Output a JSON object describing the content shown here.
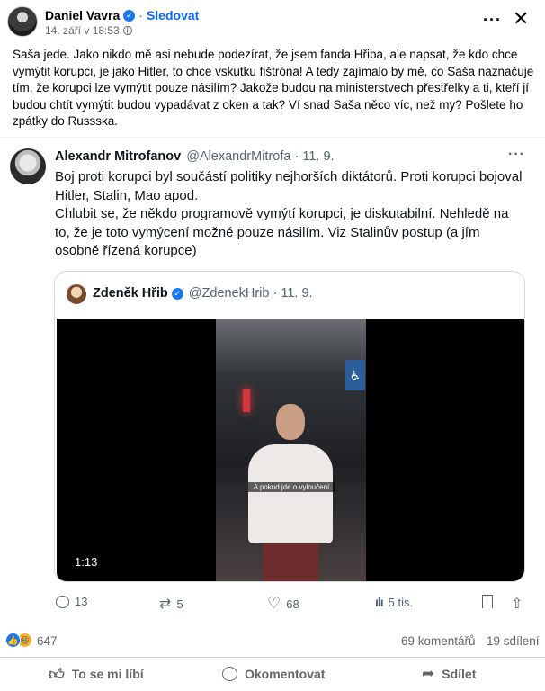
{
  "post": {
    "author": "Daniel Vavra",
    "follow_label": "Sledovat",
    "date": "14. září v 18:53",
    "text": "Saša jede. Jako nikdo mě asi nebude podezírat, že jsem fanda Hřiba, ale napsat, že kdo chce vymýtit korupci, je jako Hitler, to chce vskutku fištróna! A tedy zajímalo by mě, co Saša naznačuje tím, že korupci lze vymýtit pouze násilím? Jakože budou na ministerstvech přestřelky a ti, kteří jí budou chtít vymýtit budou vypadávat z oken a tak? Ví snad Saša něco víc, než my? Pošlete ho zpátky do Russska."
  },
  "tweet": {
    "name": "Alexandr Mitrofanov",
    "handle": "@AlexandrMitrofa · 11. 9.",
    "text": "Boj proti korupci byl součástí politiky nejhorších diktátorů. Proti korupci bojoval Hitler, Stalin, Mao apod.\nChlubit se, že někdo programově vymýtí korupci, je diskutabilní. Nehledě na to, že je toto vymýcení možné pouze násilím. Viz Stalinův postup (a jím osobně řízená korupce)",
    "quoted": {
      "name": "Zdeněk Hřib",
      "handle": "@ZdenekHrib · 11. 9.",
      "video_time": "1:13",
      "subtitle": "A pokud jde o vyloučení"
    },
    "stats": {
      "replies": "13",
      "retweets": "5",
      "likes": "68",
      "views": "5 tis."
    }
  },
  "reactions": {
    "count": "647",
    "comments": "69 komentářů",
    "shares": "19 sdílení"
  },
  "actions": {
    "like": "To se mi líbí",
    "comment": "Okomentovat",
    "share": "Sdílet"
  }
}
